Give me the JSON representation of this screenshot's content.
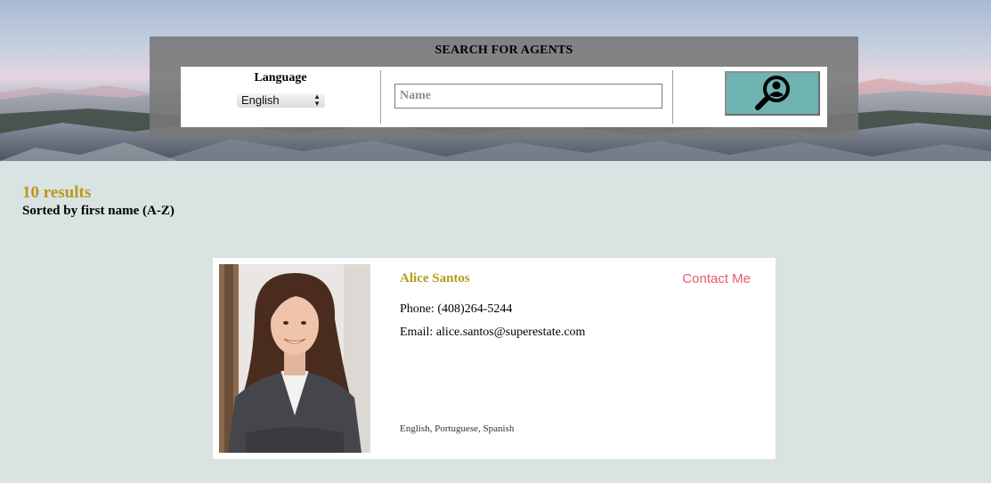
{
  "search": {
    "title": "SEARCH FOR AGENTS",
    "language_label": "Language",
    "language_selected": "English",
    "name_placeholder": "Name",
    "name_value": ""
  },
  "results": {
    "count_label": "10 results",
    "sort_label": "Sorted by first name (A-Z)"
  },
  "agent": {
    "name": "Alice Santos",
    "contact_label": "Contact Me",
    "phone_line": "Phone: (408)264-5244",
    "email_line": "Email: alice.santos@superestate.com",
    "languages": "English, Portuguese, Spanish"
  },
  "colors": {
    "accent_gold": "#b59a1e",
    "contact_red": "#e8596b",
    "search_teal": "#6eb3b1",
    "page_bg": "#d9e3e2"
  },
  "icons": {
    "search_button": "magnifier-icon",
    "select_arrows": "updown-arrows-icon"
  }
}
